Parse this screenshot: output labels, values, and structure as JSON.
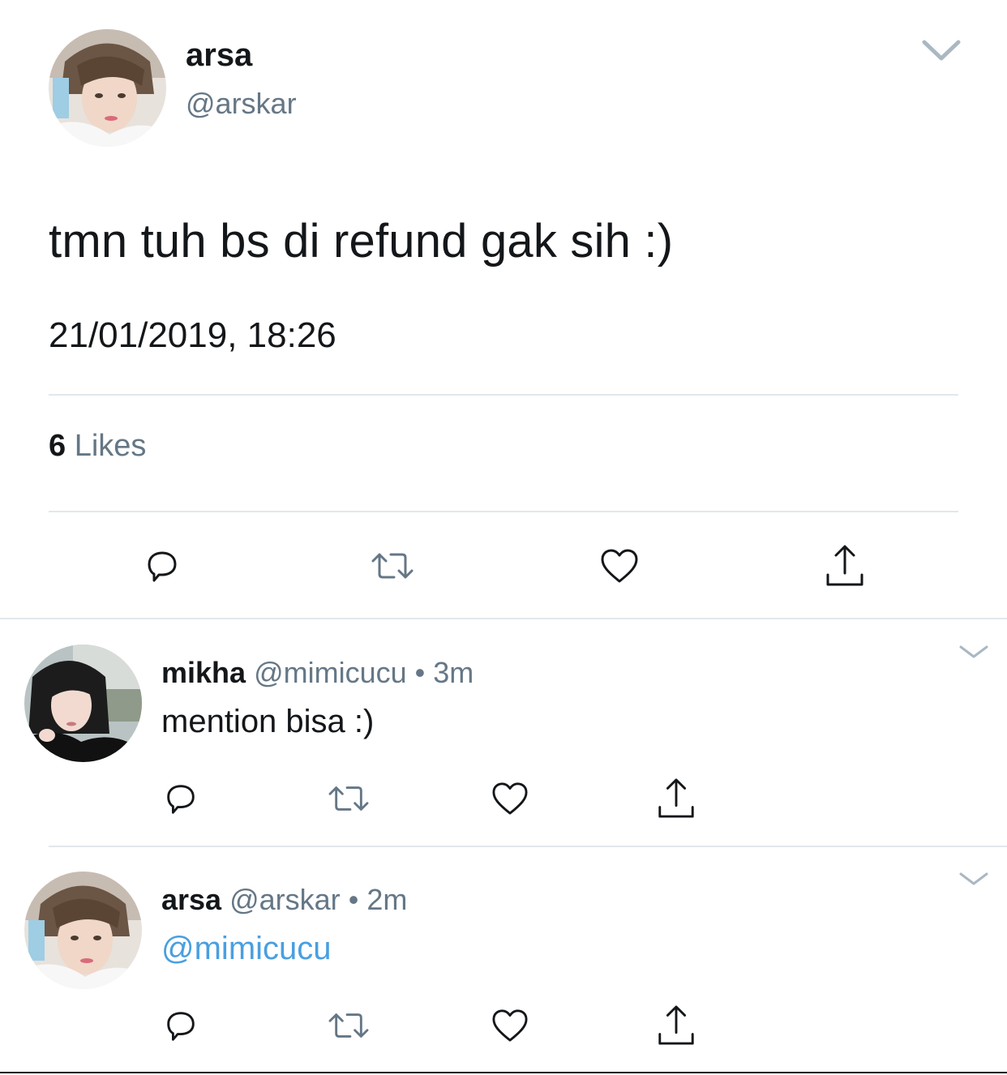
{
  "main_tweet": {
    "display_name": "arsa",
    "handle": "@arskar",
    "text": "tmn tuh bs di refund gak sih :)",
    "timestamp": "21/01/2019, 18:26",
    "likes_count": "6",
    "likes_label": "Likes",
    "avatar_icon": "avatar-photo",
    "menu_icon": "chevron-down-icon"
  },
  "replies": [
    {
      "display_name": "mikha",
      "handle": "@mimicucu",
      "separator": "•",
      "time": "3m",
      "text": "mention bisa :)"
    },
    {
      "display_name": "arsa",
      "handle": "@arskar",
      "separator": "•",
      "time": "2m",
      "text": "@mimicucu"
    }
  ],
  "actions": [
    "reply-icon",
    "retweet-icon",
    "like-icon",
    "share-icon"
  ],
  "colors": {
    "text": "#14171a",
    "secondary": "#657786",
    "link": "#4a9fe0",
    "divider": "#e1e8ed",
    "icon": "#657786"
  }
}
